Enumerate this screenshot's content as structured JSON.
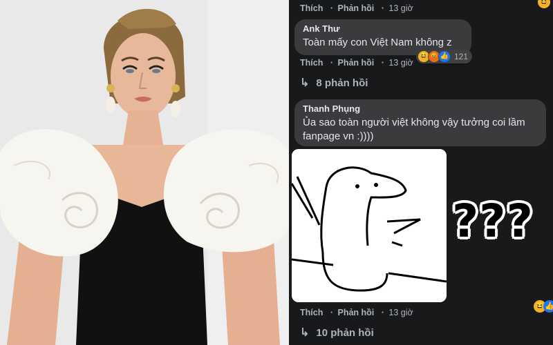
{
  "comments": [
    {
      "author": "",
      "actions": {
        "like": "Thích",
        "reply": "Phản hồi",
        "time": "13 giờ"
      }
    },
    {
      "author": "Ank Thư",
      "text": "Toàn mấy con Việt Nam không z",
      "reaction_count": "121",
      "reactions": [
        "haha",
        "angry",
        "like"
      ],
      "actions": {
        "like": "Thích",
        "reply": "Phản hồi",
        "time": "13 giờ"
      },
      "replies_label": "8 phản hồi"
    },
    {
      "author": "Thanh Phụng",
      "text_line1": "Ủa sao toàn người việt không vậy tưởng coi lầm",
      "text_line2": "fanpage vn :))))",
      "reactions": [
        "haha",
        "like"
      ],
      "actions": {
        "like": "Thích",
        "reply": "Phản hồi",
        "time": "13 giờ"
      },
      "replies_label": "10 phản hồi"
    }
  ],
  "overlay_text": "???",
  "colors": {
    "background": "#18191a",
    "bubble": "#3a3b3c",
    "muted_text": "#b0b3b8",
    "primary_text": "#e4e6eb",
    "like_blue": "#1877f2",
    "haha_yellow": "#f7b125"
  },
  "icons": {
    "reply_arrow": "reply-arrow-icon",
    "haha": "haha-reaction-icon",
    "angry": "angry-reaction-icon",
    "like": "like-reaction-icon"
  }
}
